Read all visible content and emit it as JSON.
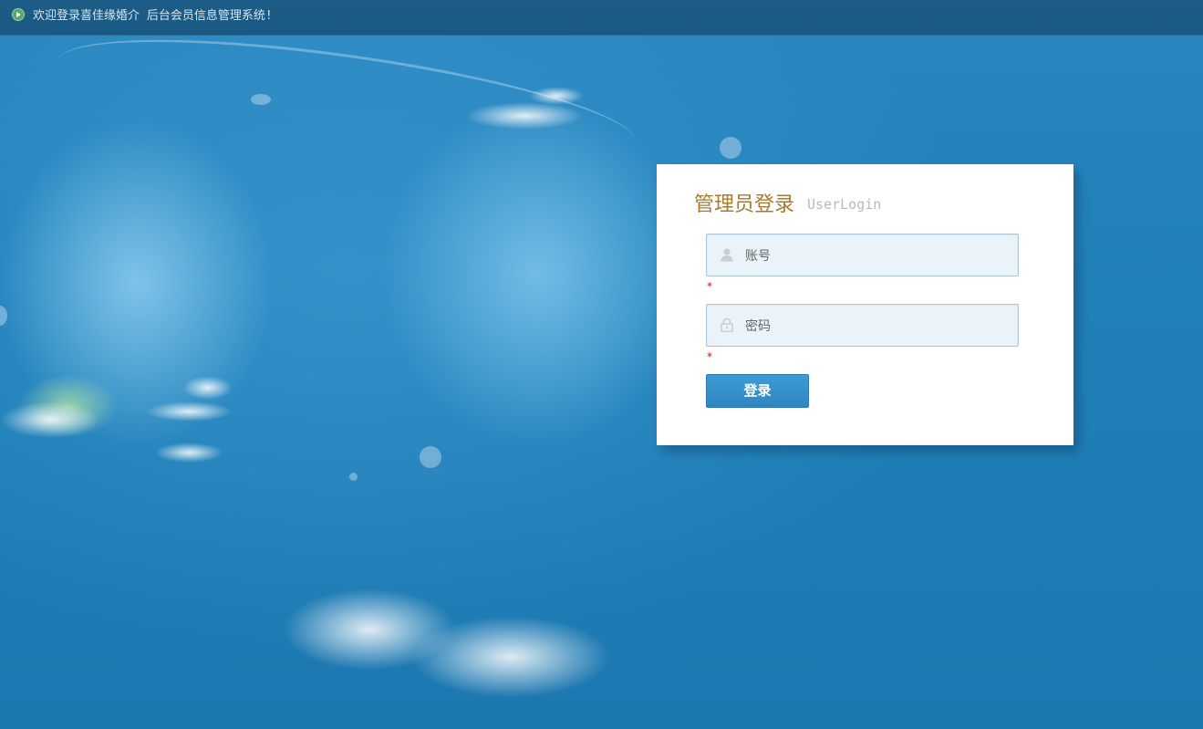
{
  "topbar": {
    "welcome_text": "欢迎登录喜佳缘婚介 后台会员信息管理系统!",
    "icon": "play-icon"
  },
  "login_panel": {
    "title": "管理员登录",
    "subtitle": "UserLogin",
    "username": {
      "placeholder": "账号",
      "icon": "user-icon",
      "required_mark": "*"
    },
    "password": {
      "placeholder": "密码",
      "icon": "lock-icon",
      "required_mark": "*"
    },
    "submit_label": "登录"
  },
  "colors": {
    "background": "#1e78b0",
    "topbar": "#1c5c86",
    "title": "#a87a2e",
    "button": "#3a93cd",
    "required": "#cc1111"
  }
}
